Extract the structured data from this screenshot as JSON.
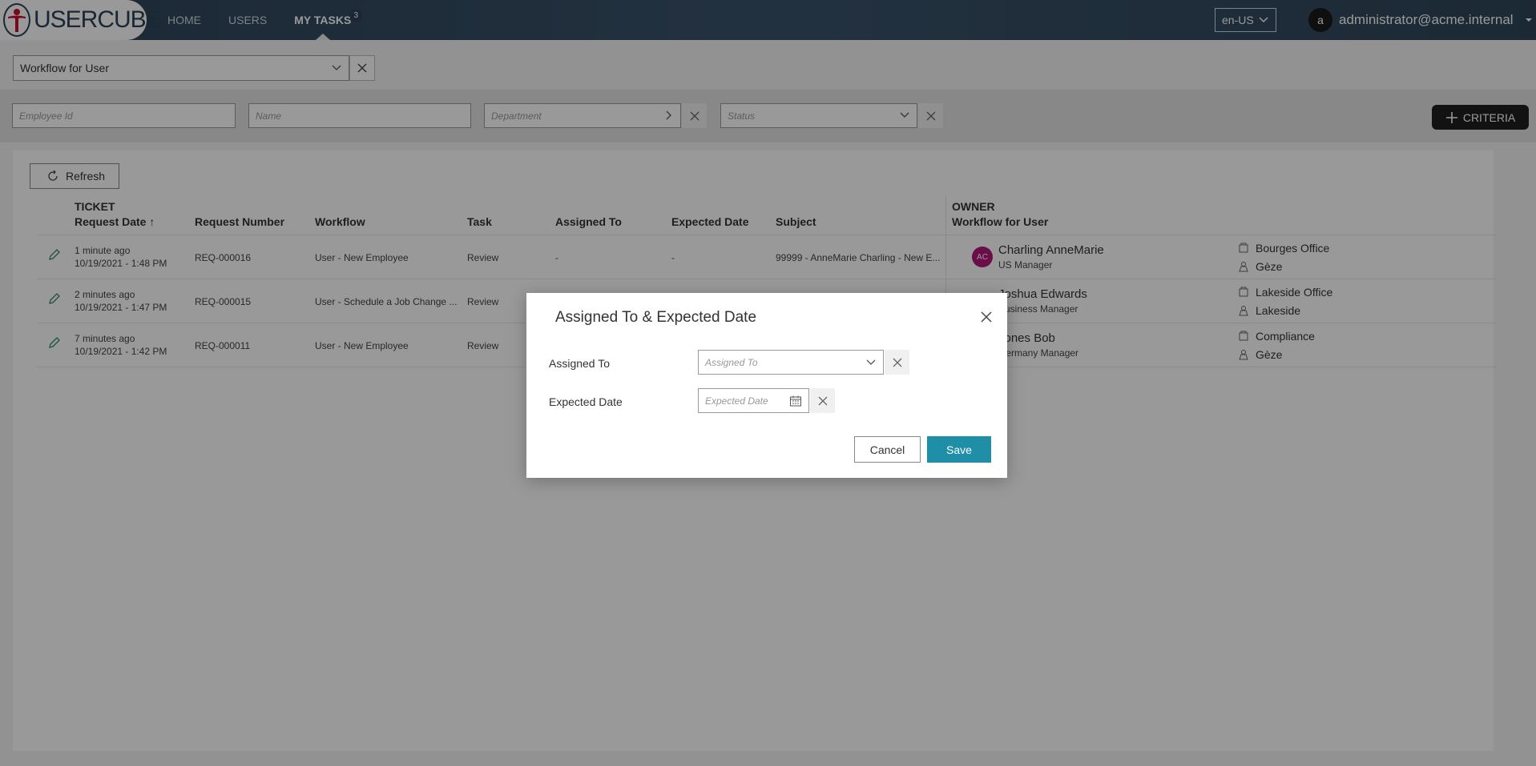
{
  "app": {
    "logo_text": "USERCUBE",
    "nav": [
      {
        "label": "HOME"
      },
      {
        "label": "USERS"
      },
      {
        "label": "MY TASKS",
        "badge": "3"
      }
    ],
    "language": "en-US",
    "user": {
      "initial": "a",
      "email": "administrator@acme.internal"
    }
  },
  "workflow_select": {
    "value": "Workflow for User"
  },
  "filters": {
    "employee_id_placeholder": "Employee Id",
    "name_placeholder": "Name",
    "department_placeholder": "Department",
    "status_placeholder": "Status",
    "criteria_label": "CRITERIA"
  },
  "refresh_label": "Refresh",
  "table": {
    "group_ticket": "TICKET",
    "group_owner": "OWNER",
    "columns": {
      "request_date": "Request Date",
      "sort_indicator": "↑",
      "request_number": "Request Number",
      "workflow": "Workflow",
      "task": "Task",
      "assigned_to": "Assigned To",
      "expected_date": "Expected Date",
      "subject": "Subject",
      "owner_workflow": "Workflow for User"
    },
    "rows": [
      {
        "ago": "1 minute ago",
        "date": "10/19/2021 - 1:48 PM",
        "number": "REQ-000016",
        "workflow": "User - New Employee",
        "task": "Review",
        "assigned": "-",
        "expected": "-",
        "subject": "99999 - AnneMarie Charling - New E...",
        "owner_initials": "AC",
        "owner_name": "Charling AnneMarie",
        "owner_title": "US Manager",
        "location": "Bourges Office",
        "org": "Gèze"
      },
      {
        "ago": "2 minutes ago",
        "date": "10/19/2021 - 1:47 PM",
        "number": "REQ-000015",
        "workflow": "User - Schedule a Job Change ...",
        "task": "Review",
        "assigned": "",
        "expected": "",
        "subject": "",
        "owner_initials": "",
        "owner_name": "Joshua Edwards",
        "owner_title": "Business Manager",
        "location": "Lakeside Office",
        "org": "Lakeside"
      },
      {
        "ago": "7 minutes ago",
        "date": "10/19/2021 - 1:42 PM",
        "number": "REQ-000011",
        "workflow": "User - New Employee",
        "task": "Review",
        "assigned": "",
        "expected": "",
        "subject": "",
        "owner_initials": "",
        "owner_name": "Jones Bob",
        "owner_title": "Germany Manager",
        "location": "Compliance",
        "org": "Gèze"
      }
    ]
  },
  "modal": {
    "title": "Assigned To & Expected Date",
    "assigned_label": "Assigned To",
    "assigned_placeholder": "Assigned To",
    "expected_label": "Expected Date",
    "expected_placeholder": "Expected Date",
    "cancel_label": "Cancel",
    "save_label": "Save"
  },
  "colors": {
    "topbar": "#2e4358",
    "save_button": "#1f8fa8",
    "criteria_button": "#1f1f1f",
    "owner_avatar": "#b3177a"
  }
}
